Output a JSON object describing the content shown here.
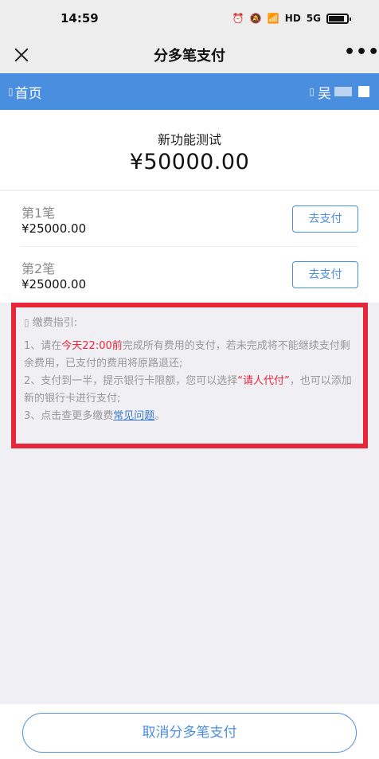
{
  "status_bar": {
    "time": "14:59",
    "network": "5G",
    "hd": "HD"
  },
  "title_bar": {
    "title": "分多笔支付",
    "more": "•••"
  },
  "nav": {
    "home_label": "首页",
    "user_label": "吴",
    "glyph": "▯"
  },
  "payment": {
    "subject": "新功能测试",
    "total": "¥50000.00"
  },
  "installments": [
    {
      "name": "第1笔",
      "amount": "¥25000.00",
      "button": "去支付"
    },
    {
      "name": "第2笔",
      "amount": "¥25000.00",
      "button": "去支付"
    }
  ],
  "guide": {
    "title": "缴费指引:",
    "item1_pre": "1、请在",
    "item1_highlight": "今天22:00前",
    "item1_post": "完成所有费用的支付，若未完成将不能继续支付剩余费用，已支付的费用将原路退还;",
    "item2_pre": "2、支付到一半，提示银行卡限额，您可以选择",
    "item2_highlight": "“请人代付”",
    "item2_post": "，也可以添加新的银行卡进行支付;",
    "item3_pre": "3、点击查更多缴费",
    "item3_link": "常见问题",
    "item3_post": "。",
    "highlight_color": "#e8263a"
  },
  "bottom": {
    "cancel_label": "取消分多笔支付"
  },
  "colors": {
    "accent": "#4a8ee0",
    "alert_red": "#e8263a"
  }
}
